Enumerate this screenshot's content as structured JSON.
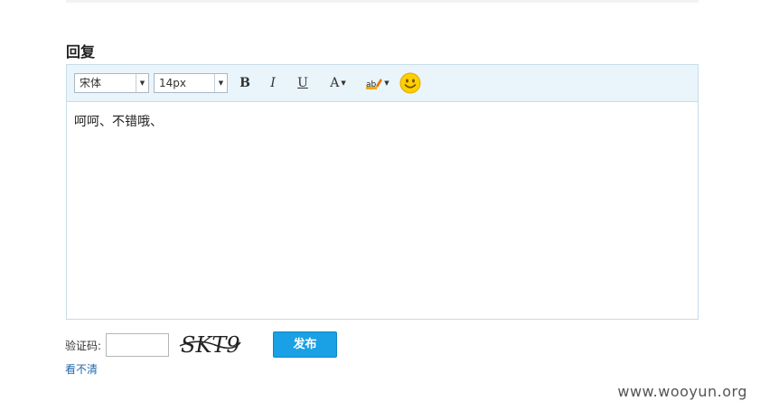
{
  "reply": {
    "title": "回复"
  },
  "toolbar": {
    "font_family": "宋体",
    "font_size": "14px",
    "bold_label": "B",
    "italic_label": "I",
    "underline_label": "U",
    "font_color_label": "A",
    "highlight_icon": "highlight-marker-icon",
    "emoji_icon": "smiley-icon"
  },
  "editor": {
    "content": "呵呵、不错哦、"
  },
  "captcha": {
    "label": "验证码:",
    "input_value": "",
    "image_text": "SKT9",
    "refresh_label": "看不清"
  },
  "submit": {
    "label": "发布"
  },
  "watermark": "www.wooyun.org",
  "colors": {
    "toolbar_bg": "#eaf4fb",
    "editor_border": "#c7dcea",
    "submit_bg": "#1aa0e4",
    "link": "#2268a8"
  }
}
